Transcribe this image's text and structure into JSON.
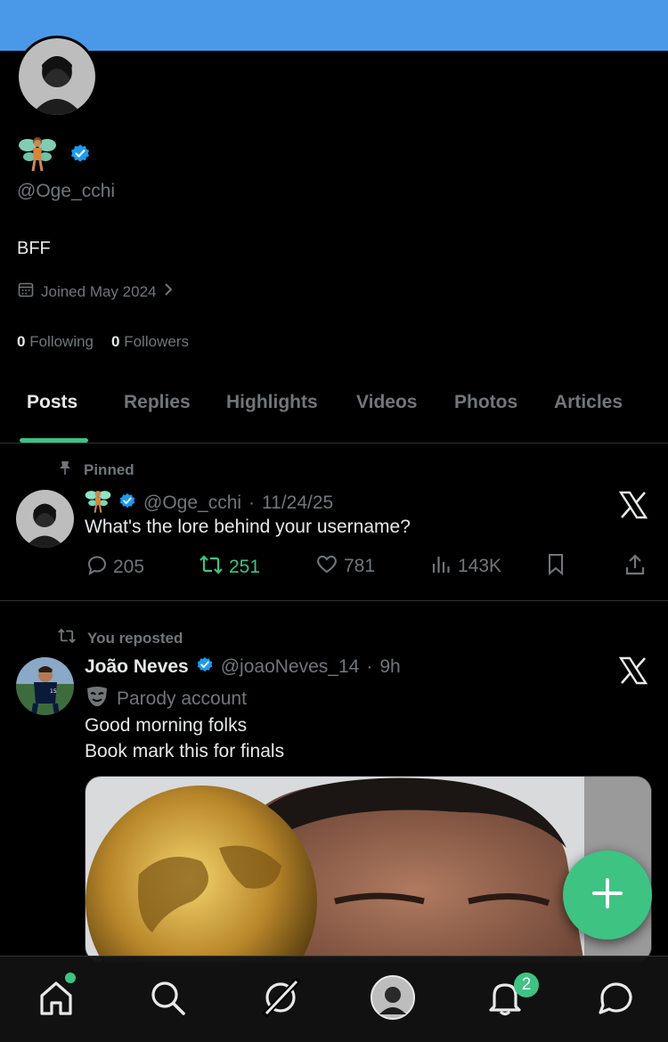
{
  "profile": {
    "handle": "@Oge_cchi",
    "bio": "BFF",
    "joined": "Joined May 2024",
    "following_count": "0",
    "following_label": "Following",
    "followers_count": "0",
    "followers_label": "Followers",
    "name_icon": "fairy-emoji",
    "verified_icon": "verified-badge"
  },
  "tabs": [
    {
      "label": "Posts",
      "active": true
    },
    {
      "label": "Replies"
    },
    {
      "label": "Highlights"
    },
    {
      "label": "Videos"
    },
    {
      "label": "Photos"
    },
    {
      "label": "Articles"
    }
  ],
  "posts": [
    {
      "context": "Pinned",
      "handle": "@Oge_cchi",
      "sep": "·",
      "time": "11/24/25",
      "text": "What's the lore behind your username?",
      "replies": "205",
      "reposts": "251",
      "likes": "781",
      "views": "143K"
    },
    {
      "context": "You reposted",
      "name": "João Neves",
      "handle": "@joaoNeves_14",
      "sep": "·",
      "time": "9h",
      "label": "Parody account",
      "text_line1": "Good morning folks",
      "text_line2": "Book mark this for finals"
    }
  ],
  "nav": {
    "notifications_badge": "2"
  },
  "colors": {
    "accent": "#3ec383",
    "banner": "#4a99e9",
    "verified": "#1d9bf0"
  }
}
